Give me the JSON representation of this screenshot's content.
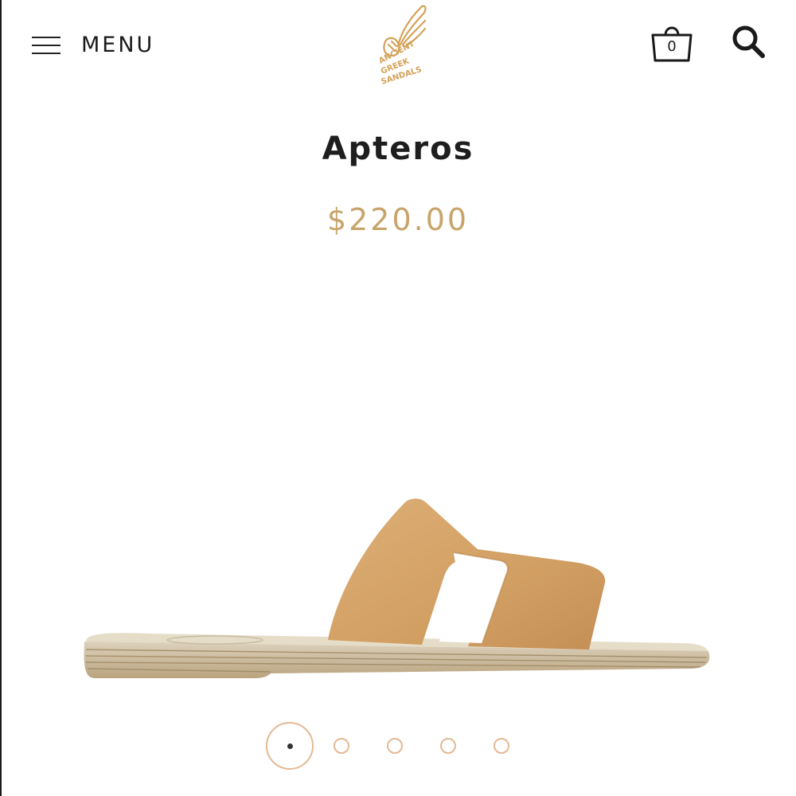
{
  "header": {
    "menu_label": "MENU",
    "cart_count": "0",
    "logo_text": [
      "ANCIENT",
      "GREEK",
      "SANDALS"
    ]
  },
  "product": {
    "title": "Apteros",
    "price": "$220.00"
  },
  "carousel": {
    "total_images": 5,
    "active_index": 0
  },
  "colors": {
    "accent": "#c8a46a",
    "dot_border": "#e2b994",
    "leather": "#d6a56b",
    "text": "#1e1e1e"
  },
  "icons": {
    "menu": "hamburger-icon",
    "cart": "shopping-bag-icon",
    "search": "search-icon",
    "logo": "winged-sandal-logo"
  }
}
